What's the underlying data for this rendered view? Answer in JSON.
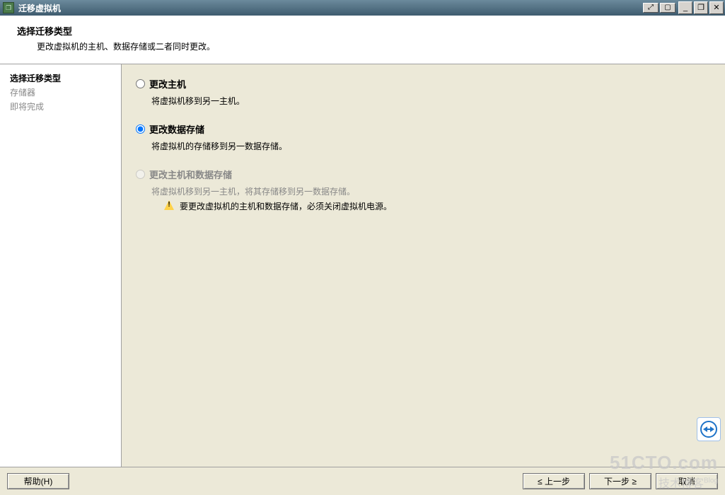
{
  "window": {
    "title": "迁移虚拟机"
  },
  "header": {
    "title": "选择迁移类型",
    "desc": "更改虚拟机的主机、数据存储或二者同时更改。"
  },
  "nav": {
    "items": [
      {
        "label": "选择迁移类型",
        "state": "active"
      },
      {
        "label": "存储器",
        "state": "inactive"
      },
      {
        "label": "即将完成",
        "state": "inactive"
      }
    ]
  },
  "options": {
    "opt1": {
      "label": "更改主机",
      "desc": "将虚拟机移到另一主机。",
      "selected": false,
      "disabled": false
    },
    "opt2": {
      "label": "更改数据存储",
      "desc": "将虚拟机的存储移到另一数据存储。",
      "selected": true,
      "disabled": false
    },
    "opt3": {
      "label": "更改主机和数据存储",
      "desc": "将虚拟机移到另一主机，将其存储移到另一数据存储。",
      "warning": "要更改虚拟机的主机和数据存储，必须关闭虚拟机电源。",
      "disabled": true
    }
  },
  "buttons": {
    "help": "帮助(H)",
    "back": "≤ 上一步",
    "next": "下一步 ≥",
    "cancel": "取消"
  },
  "watermark": {
    "line1": "51CTO.com",
    "line2": "技术博客",
    "blog": "Blog"
  }
}
